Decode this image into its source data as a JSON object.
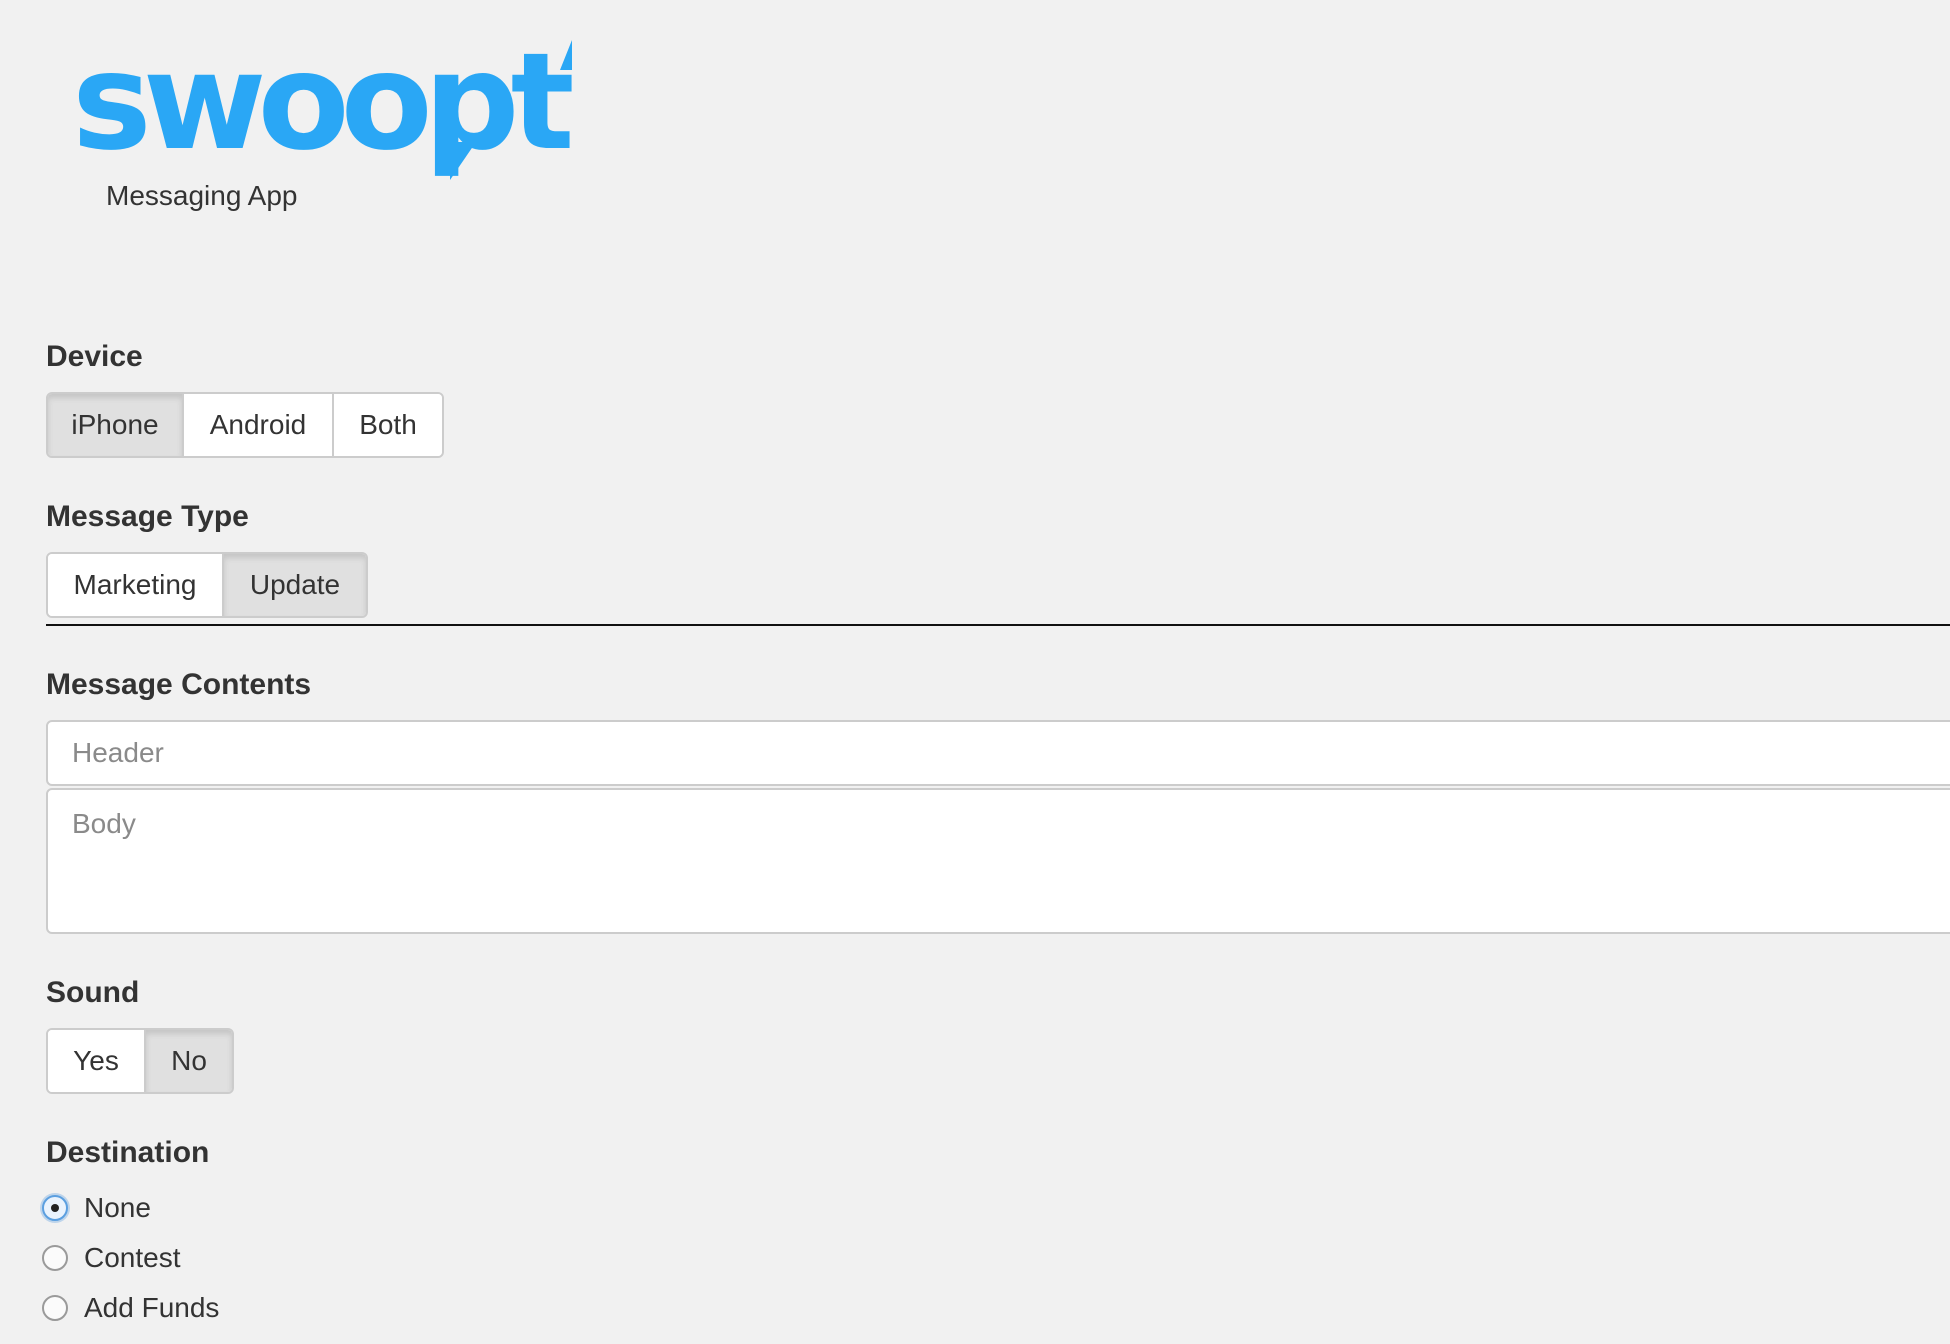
{
  "brand": {
    "logo_text": "swoopt",
    "logo_color": "#2aa7f5",
    "tagline": "Messaging App"
  },
  "device": {
    "label": "Device",
    "options": [
      "iPhone",
      "Android",
      "Both"
    ],
    "selected": "iPhone"
  },
  "message_type": {
    "label": "Message Type",
    "options": [
      "Marketing",
      "Update"
    ],
    "selected": "Update"
  },
  "message_contents": {
    "label": "Message Contents",
    "header_placeholder": "Header",
    "body_placeholder": "Body"
  },
  "sound": {
    "label": "Sound",
    "options": [
      "Yes",
      "No"
    ],
    "selected": "No"
  },
  "destination": {
    "label": "Destination",
    "options": [
      "None",
      "Contest",
      "Add Funds"
    ],
    "selected": "None"
  }
}
